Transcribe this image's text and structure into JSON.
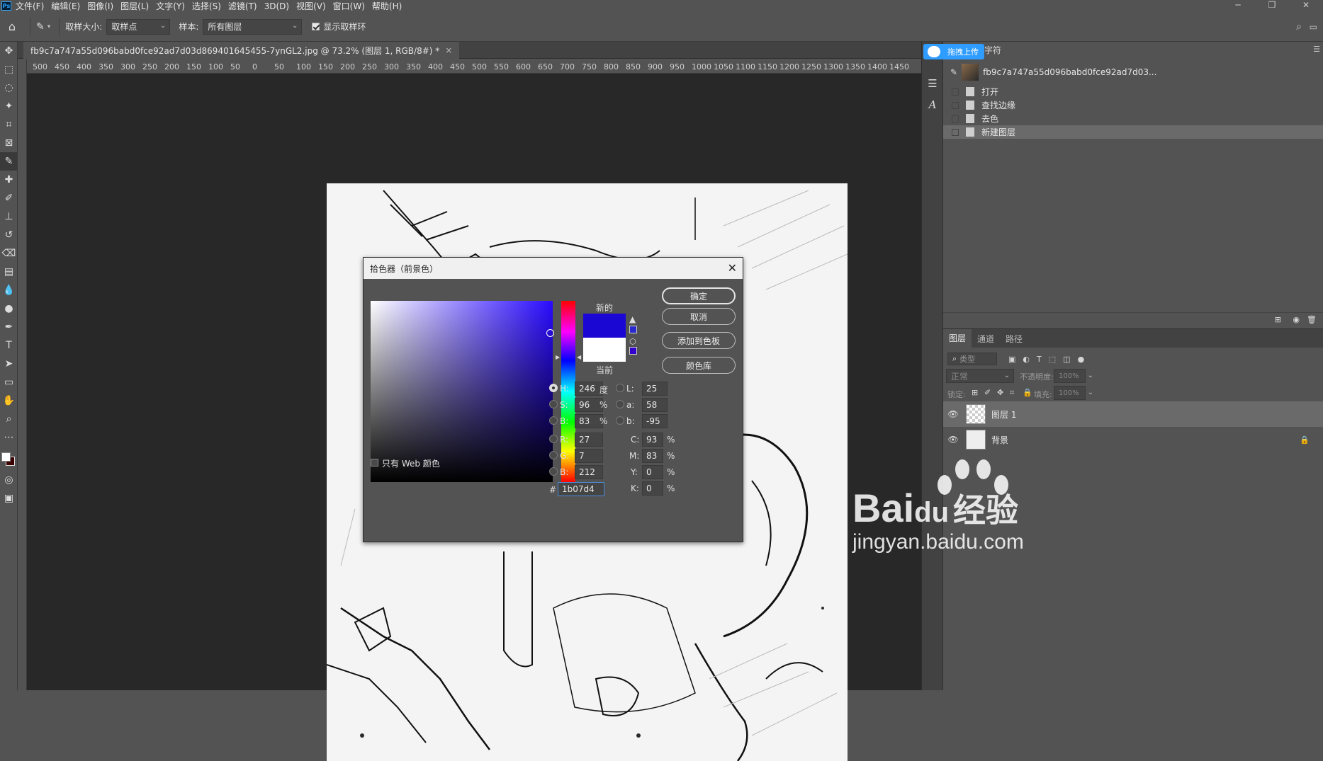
{
  "menubar": {
    "app_icon": "Ps",
    "items": [
      "文件(F)",
      "编辑(E)",
      "图像(I)",
      "图层(L)",
      "文字(Y)",
      "选择(S)",
      "滤镜(T)",
      "3D(D)",
      "视图(V)",
      "窗口(W)",
      "帮助(H)"
    ]
  },
  "options": {
    "sample_size_label": "取样大小:",
    "sample_size_value": "取样点",
    "sample_label": "样本:",
    "sample_value": "所有图层",
    "show_ring_label": "显示取样环"
  },
  "document": {
    "tab_title": "fb9c7a747a55d096babd0fce92ad7d03d869401645455-7ynGL2.jpg @ 73.2% (图层 1, RGB/8#) *",
    "tab_close": "×"
  },
  "ruler": {
    "ticks": [
      "500",
      "450",
      "400",
      "350",
      "300",
      "250",
      "200",
      "150",
      "100",
      "50",
      "0",
      "50",
      "100",
      "150",
      "200",
      "250",
      "300",
      "350",
      "400",
      "450",
      "500",
      "550",
      "600",
      "650",
      "700",
      "750",
      "800",
      "850",
      "900",
      "950",
      "1000",
      "1050",
      "1100",
      "1150",
      "1200",
      "1250",
      "1300",
      "1350",
      "1400",
      "1450"
    ]
  },
  "dialog": {
    "title": "拾色器（前景色）",
    "close": "✕",
    "new_label": "新的",
    "current_label": "当前",
    "ok": "确定",
    "cancel": "取消",
    "add_swatch": "添加到色板",
    "color_libraries": "颜色库",
    "web_only": "只有 Web 颜色",
    "fields": {
      "H": {
        "label": "H:",
        "value": "246",
        "unit": "度"
      },
      "S": {
        "label": "S:",
        "value": "96",
        "unit": "%"
      },
      "B": {
        "label": "B:",
        "value": "83",
        "unit": "%"
      },
      "R": {
        "label": "R:",
        "value": "27"
      },
      "G": {
        "label": "G:",
        "value": "7"
      },
      "Bl": {
        "label": "B:",
        "value": "212"
      },
      "L": {
        "label": "L:",
        "value": "25"
      },
      "a": {
        "label": "a:",
        "value": "58"
      },
      "b": {
        "label": "b:",
        "value": "-95"
      },
      "C": {
        "label": "C:",
        "value": "93",
        "unit": "%"
      },
      "M": {
        "label": "M:",
        "value": "83",
        "unit": "%"
      },
      "Y": {
        "label": "Y:",
        "value": "0",
        "unit": "%"
      },
      "K": {
        "label": "K:",
        "value": "0",
        "unit": "%"
      },
      "hex_label": "#",
      "hex": "1b07d4"
    },
    "new_color": "#1b07d4",
    "current_color": "#ffffff"
  },
  "panel": {
    "badge": "拖拽上传",
    "char_tab": "字符",
    "history_snapshot": "fb9c7a747a55d096babd0fce92ad7d03...",
    "history": [
      "打开",
      "查找边缘",
      "去色",
      "新建图层"
    ],
    "layers_tabs": [
      "图层",
      "通道",
      "路径"
    ],
    "filter_placeholder": "类型",
    "blend_mode": "正常",
    "opacity_label": "不透明度:",
    "opacity_value": "100%",
    "lock_label": "锁定:",
    "fill_label": "填充:",
    "fill_value": "100%",
    "layers": [
      {
        "name": "图层 1"
      },
      {
        "name": "背景"
      }
    ]
  },
  "watermark": {
    "brand": "Bai",
    "brand2": "du",
    "cn": "经验",
    "url": "jingyan.baidu.com"
  }
}
